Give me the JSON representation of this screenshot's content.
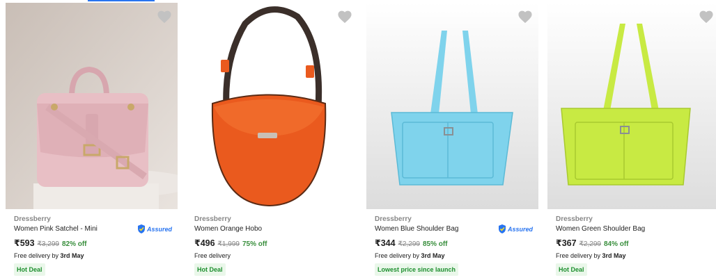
{
  "products": [
    {
      "brand": "Dressberry",
      "title": "Women Pink Satchel - Mini",
      "assured": true,
      "assured_label": "Assured",
      "price": "₹593",
      "mrp": "₹3,299",
      "discount": "82% off",
      "delivery_prefix": "Free delivery by",
      "delivery_date": "3rd May",
      "deal": "Hot Deal",
      "bag_color": "#e8bfc5"
    },
    {
      "brand": "Dressberry",
      "title": "Women Orange Hobo",
      "assured": false,
      "price": "₹496",
      "mrp": "₹1,999",
      "discount": "75% off",
      "delivery_prefix": "Free delivery",
      "delivery_date": "",
      "deal": "Hot Deal",
      "bag_color": "#ea5a1e"
    },
    {
      "brand": "Dressberry",
      "title": "Women Blue Shoulder Bag",
      "assured": true,
      "assured_label": "Assured",
      "price": "₹344",
      "mrp": "₹2,299",
      "discount": "85% off",
      "delivery_prefix": "Free delivery by",
      "delivery_date": "3rd May",
      "deal": "Lowest price since launch",
      "bag_color": "#7fd3ec"
    },
    {
      "brand": "Dressberry",
      "title": "Women Green Shoulder Bag",
      "assured": false,
      "price": "₹367",
      "mrp": "₹2,299",
      "discount": "84% off",
      "delivery_prefix": "Free delivery by",
      "delivery_date": "3rd May",
      "deal": "Hot Deal",
      "bag_color": "#c8ea43"
    }
  ],
  "colors": {
    "accent": "#2874f0",
    "discount_green": "#388e3c",
    "deal_bg": "#eaf7ea",
    "deal_text": "#1e8f2f",
    "heart": "#c2c2c2"
  },
  "icons": [
    "heart-icon",
    "assured-badge-icon"
  ]
}
